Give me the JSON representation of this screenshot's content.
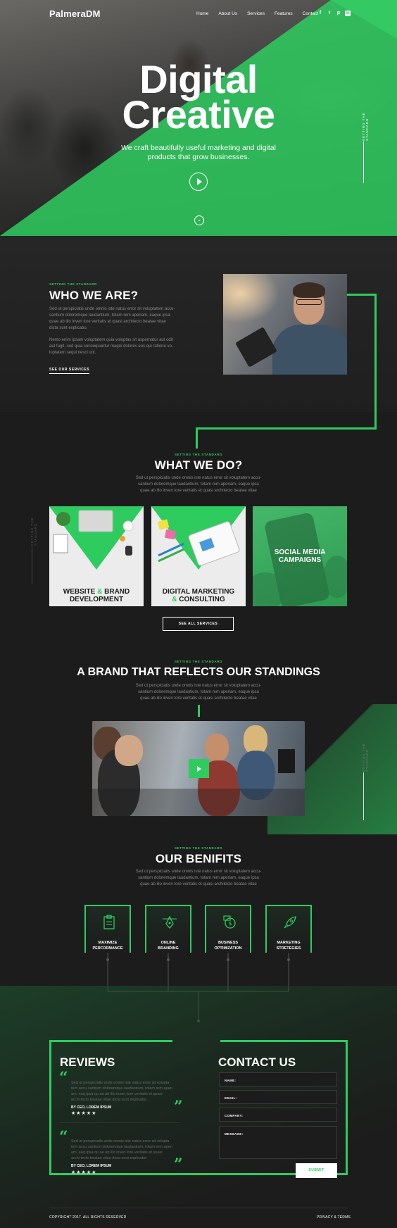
{
  "nav": {
    "logo": "PalmeraDM",
    "links": [
      "Home",
      "About Us",
      "Services",
      "Features",
      "Contact"
    ],
    "social_icons": [
      "facebook-icon",
      "twitter-icon",
      "pinterest-icon",
      "linkedin-icon"
    ]
  },
  "hero": {
    "title_line1": "Digital",
    "title_line2": "Creative",
    "subtitle_line1": "We craft beautifully useful marketing and digital",
    "subtitle_line2": "products that grow businesses.",
    "side_label": "SETTING THE STANDARD"
  },
  "who": {
    "eyebrow": "SETTING THE STANDARD",
    "title": "WHO WE ARE?",
    "p1_lines": [
      "Sed ut perspiciatis unde omnis iste natus error sit voluptatem accu-",
      "santium doloremque laudantium, totam rem aperiam, eaque ipsa",
      "quae ab illo inven tore veritatis et quasi architecto beatae vitae",
      "dicta sunt explicabo."
    ],
    "p2_lines": [
      "Nemo enim ipsam voluptatem quia voluptas sit aspernatur aut odit",
      "aut fugit, sed quia consequuntur magni dolores eos qui ratione vo-",
      "luptatem sequi nesci unt."
    ],
    "link": "SEE OUR SERVICES"
  },
  "what": {
    "eyebrow": "SETTING THE STANDARD",
    "title": "WHAT WE DO?",
    "lines": [
      "Sed ut perspiciatis unde omnis iste natus error sit voluptatem accu-",
      "santium doloremque laudantium, totam rem aperiam, eaque ipsa",
      "quae ab illo inven tore veritatis et quasi architecto beatae vitae"
    ],
    "side_label": "SETTING THE STANDARD",
    "cards": [
      {
        "l1a": "WEBSITE ",
        "amp": "&",
        "l1b": " BRAND",
        "l2": "DEVELOPMENT"
      },
      {
        "l1": "DIGITAL MARKETING",
        "amp": "&",
        "l2b": " CONSULTING"
      },
      {
        "l1": "SOCIAL MEDIA",
        "l2": "CAMPAIGNS"
      }
    ],
    "button": "SEE ALL SERVICES"
  },
  "brand": {
    "eyebrow": "SETTING THE STANDARD",
    "title": "A BRAND THAT REFLECTS OUR STANDINGS",
    "lines": [
      "Sed ut perspiciatis unde omnis iste natus error sit voluptatem accu-",
      "santium doloremque laudantium, totam rem aperiam, eaque ipsa",
      "quae ab illo inven tore veritatis et quasi architecto beatae vitae"
    ],
    "side_label": "SETTING THE STANDARD"
  },
  "benefits": {
    "eyebrow": "SETTING THE STANDARD",
    "title": "OUR BENIFITS",
    "lines": [
      "Sed ut perspiciatis unde omnis iste natus error sit voluptatem accu-",
      "santium doloremque laudantium, totam rem aperiam, eaque ipsa",
      "quae ab illo inven tore veritatis et quasi architecto beatae vitae"
    ],
    "items": [
      {
        "l1": "MAXIMIZE",
        "l2": "PERFORMANCE",
        "icon": "clipboard-icon"
      },
      {
        "l1": "ONLINE",
        "l2": "BRANDING",
        "icon": "vector-pen-icon"
      },
      {
        "l1": "BUSINESS",
        "l2": "OPTIMIZATION",
        "icon": "money-gear-icon"
      },
      {
        "l1": "MARKETING",
        "l2": "STRETEGIES",
        "icon": "rocket-icon"
      }
    ]
  },
  "reviews": {
    "title": "REVIEWS",
    "items": [
      {
        "lines": [
          "Sed ut perspiciatis unde omnis iste natus error sit volupta",
          "tem accu santium doloremque laudantium, totam rem aperi",
          "am, eaq ipsa qu ae ab illo inven tore veritatis et quasi",
          "archi tecto beatae vitae dicta sunt explicabo."
        ],
        "by": "BY CEO, LOREM IPSUM",
        "stars": "★★★★★"
      },
      {
        "lines": [
          "Sed ut perspiciatis unde omnis iste natus error sit volupta",
          "tem accu santium doloremque laudantium, totam rem aperi",
          "am, eaq ipsa qu ae ab illo inven tore veritatis et quasi",
          "archi tecto beatae vitae dicta sunt explicabo."
        ],
        "by": "BY CEO, LOREM IPSUM",
        "stars": "★★★★★"
      }
    ]
  },
  "contact": {
    "title": "CONTACT US",
    "fields": [
      "NAME:",
      "EMAIL:",
      "COMPANY:",
      "MESSAGE:"
    ],
    "submit": "SUBMIT"
  },
  "footer": {
    "copyright": "COPYRIGHT 2017. ALL RIGHTS RESERVED",
    "privacy": "PRIVACY & TERMS"
  },
  "colors": {
    "accent": "#2ecc5f",
    "background": "#1c1c1c"
  }
}
